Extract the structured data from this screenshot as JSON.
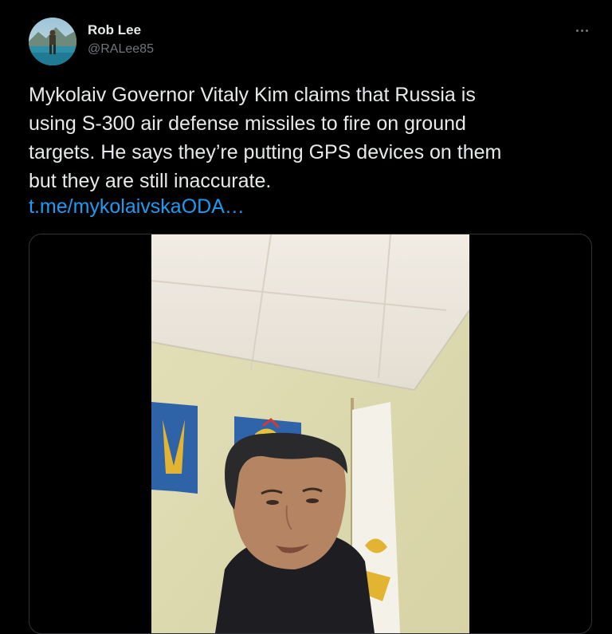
{
  "author": {
    "display_name": "Rob Lee",
    "handle": "@RALee85"
  },
  "tweet": {
    "text": "Mykolaiv Governor Vitaly Kim claims that Russia is\nusing S-300 air defense missiles to fire on ground\ntargets. He says they’re putting GPS devices on them\nbut they are still inaccurate.",
    "link": "t.me/mykolaivskaODA…"
  },
  "icons": {
    "more": "more-horizontal-icon",
    "avatar": "profile-photo"
  },
  "colors": {
    "background": "#000000",
    "text_primary": "#e7e9ea",
    "text_secondary": "#71767b",
    "link": "#1d9bf0",
    "border": "#2f3336"
  }
}
